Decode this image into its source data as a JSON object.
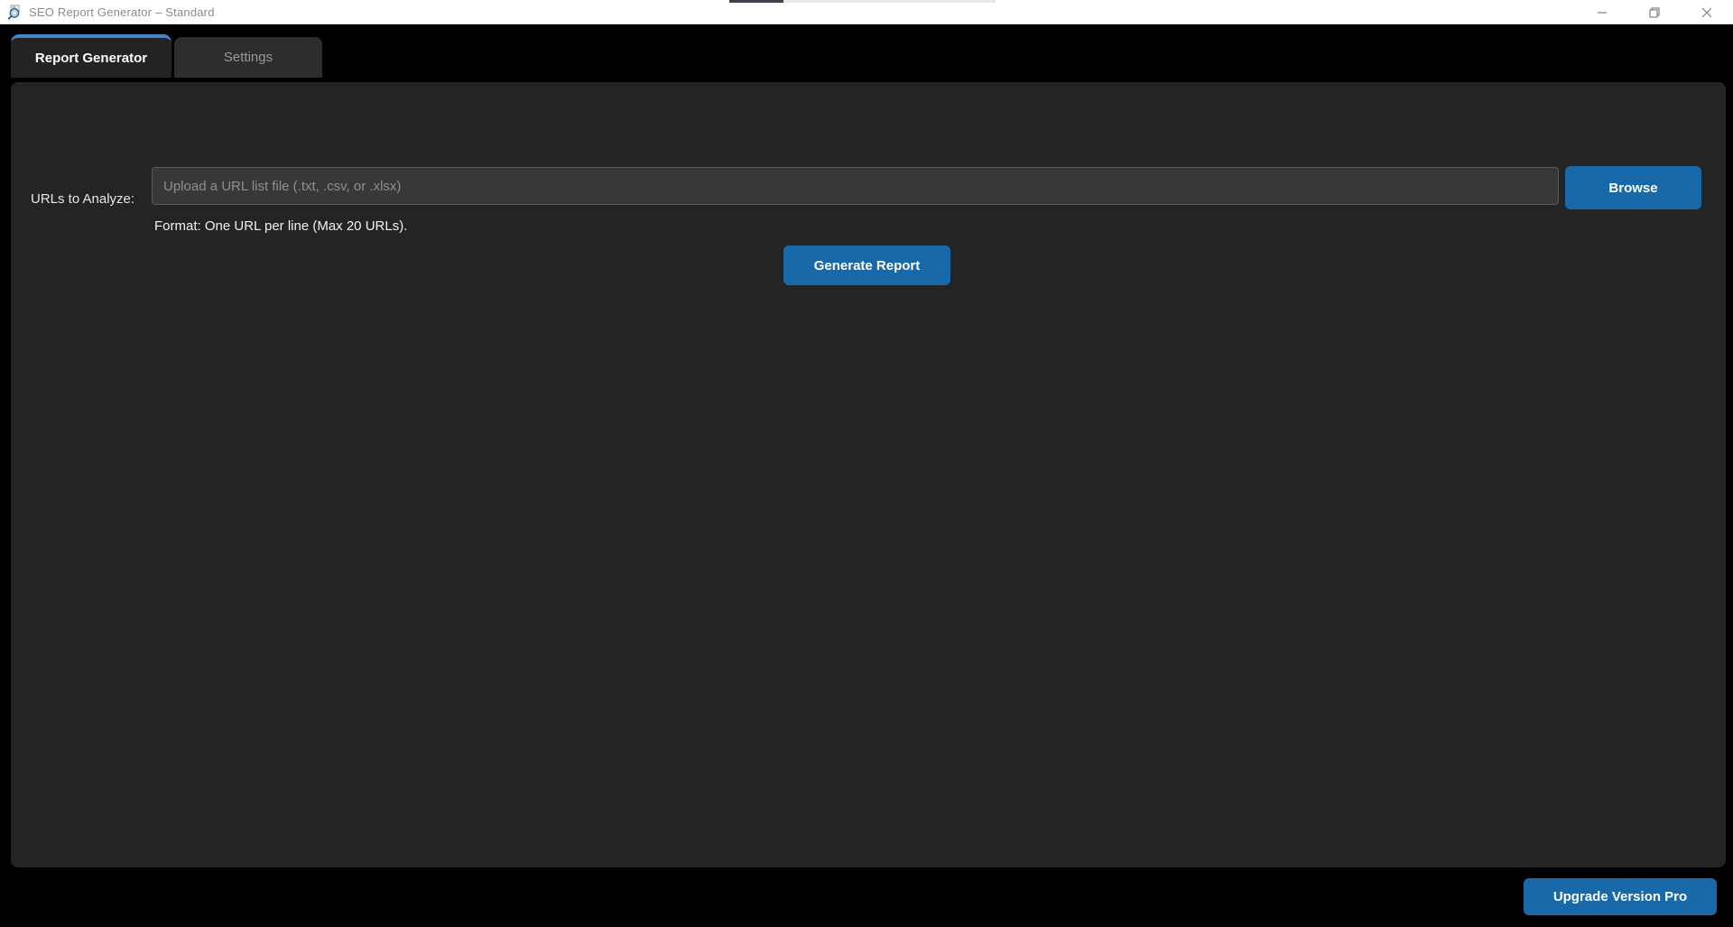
{
  "window": {
    "title": "SEO Report Generator – Standard",
    "controls": [
      {
        "name": "minimize-button",
        "icon": "minimize-icon"
      },
      {
        "name": "restore-button",
        "icon": "restore-icon"
      },
      {
        "name": "close-button",
        "icon": "close-icon"
      }
    ],
    "app_icon": "magnifier-document-icon"
  },
  "tabs": [
    {
      "label": "Report Generator",
      "active": true
    },
    {
      "label": "Settings",
      "active": false
    }
  ],
  "form": {
    "url_label": "URLs to Analyze:",
    "file_input_value": "",
    "file_input_placeholder": "Upload a URL list file (.txt, .csv, or .xlsx)",
    "browse_label": "Browse",
    "format_hint": "Format: One URL per line (Max 20 URLs).",
    "generate_label": "Generate Report"
  },
  "footer": {
    "upgrade_label": "Upgrade Version Pro"
  },
  "colors": {
    "accent_blue": "#1769aa",
    "tab_highlight_blue": "#4584c8",
    "panel_bg": "#242424",
    "window_bg": "#000000",
    "titlebar_bg": "#ffffff"
  }
}
